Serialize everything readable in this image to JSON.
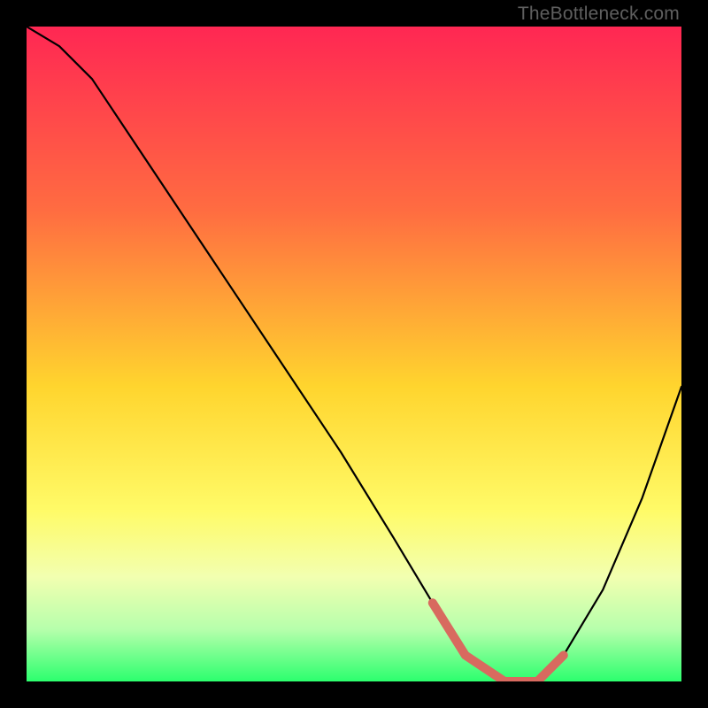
{
  "watermark": "TheBottleneck.com",
  "chart_data": {
    "type": "line",
    "title": "",
    "xlabel": "",
    "ylabel": "",
    "xlim": [
      0,
      100
    ],
    "ylim": [
      0,
      100
    ],
    "grid": false,
    "legend": false,
    "background_gradient_stops": [
      {
        "offset": 0,
        "color": "#ff2753"
      },
      {
        "offset": 28,
        "color": "#ff6c41"
      },
      {
        "offset": 55,
        "color": "#ffd52e"
      },
      {
        "offset": 74,
        "color": "#fffb68"
      },
      {
        "offset": 84,
        "color": "#f2ffb0"
      },
      {
        "offset": 92,
        "color": "#b7ffac"
      },
      {
        "offset": 100,
        "color": "#2cff6e"
      }
    ],
    "series": [
      {
        "name": "bottleneck-curve",
        "x": [
          0,
          5,
          10,
          18,
          28,
          38,
          48,
          56,
          62,
          67,
          73,
          78,
          82,
          88,
          94,
          100
        ],
        "y": [
          100,
          97,
          92,
          80,
          65,
          50,
          35,
          22,
          12,
          4,
          0,
          0,
          4,
          14,
          28,
          45
        ]
      }
    ],
    "highlight_segment": {
      "name": "optimal-zone",
      "color": "#d86a5f",
      "x": [
        62,
        67,
        73,
        78,
        82
      ],
      "y": [
        12,
        4,
        0,
        0,
        4
      ]
    }
  }
}
